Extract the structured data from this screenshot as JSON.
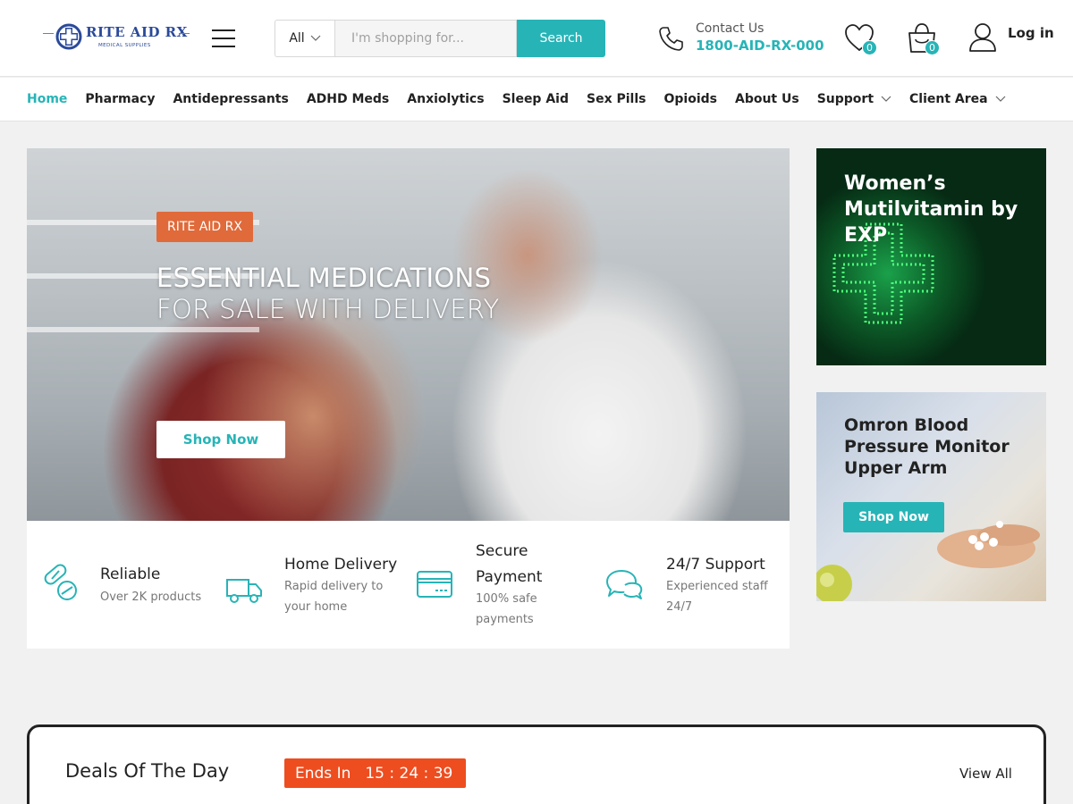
{
  "header": {
    "logo": {
      "name": "RITE AID RX",
      "sub": "MEDICAL SUPPLIES"
    },
    "search": {
      "category": "All",
      "placeholder": "I'm shopping for...",
      "button": "Search"
    },
    "contact": {
      "label": "Contact Us",
      "phone": "1800-AID-RX-000"
    },
    "wishlist_count": "0",
    "cart_count": "0",
    "login": "Log in"
  },
  "nav": {
    "items": [
      "Home",
      "Pharmacy",
      "Antidepressants",
      "ADHD Meds",
      "Anxiolytics",
      "Sleep Aid",
      "Sex Pills",
      "Opioids",
      "About Us",
      "Support",
      "Client Area"
    ]
  },
  "hero": {
    "tag": "RITE AID RX",
    "title_line1": "ESSENTIAL MEDICATIONS",
    "title_line2": "FOR SALE WITH DELIVERY",
    "button": "Shop Now"
  },
  "features": [
    {
      "title": "Reliable",
      "sub": "Over 2K products",
      "icon": "pills-icon"
    },
    {
      "title": "Home Delivery",
      "sub": "Rapid delivery to your home",
      "icon": "truck-icon"
    },
    {
      "title": "Secure Payment",
      "sub": "100% safe payments",
      "icon": "credit-card-icon"
    },
    {
      "title": "24/7 Support",
      "sub": "Experienced staff 24/7",
      "icon": "chat-bubbles-icon"
    }
  ],
  "side_banners": [
    {
      "title": "Women’s Mutilvitamin by EXP"
    },
    {
      "title": "Omron Blood Pressure Monitor Upper Arm",
      "button": "Shop Now"
    }
  ],
  "deals": {
    "title": "Deals Of The Day",
    "ends_label": "Ends In",
    "timer": "15 : 24 : 39",
    "view_all": "View All"
  },
  "colors": {
    "accent": "#27b4b7",
    "tag": "#e06a3a",
    "timer": "#ee4d1f"
  }
}
